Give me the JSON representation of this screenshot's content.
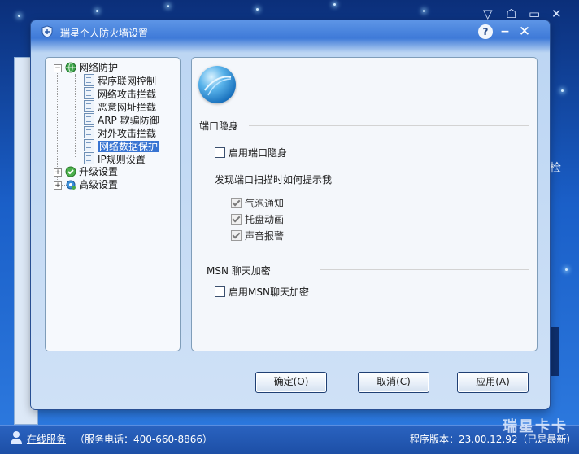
{
  "background": {
    "top_controls": [
      "▽",
      "☖",
      "▭",
      "✕"
    ],
    "right_partial_text": "检",
    "status_bar": {
      "online_service": "在线服务",
      "phone": "（服务电话：400-660-8866）",
      "version": "程序版本：23.00.12.92（已是最新）"
    },
    "watermark": "瑞星卡卡"
  },
  "dialog": {
    "title": "瑞星个人防火墙设置",
    "controls": {
      "help": "?",
      "minimize": "−",
      "close": "✕"
    },
    "tree": {
      "network_protection": "网络防护",
      "children": [
        "程序联网控制",
        "网络攻击拦截",
        "恶意网址拦截",
        "ARP 欺骗防御",
        "对外攻击拦截",
        "网络数据保护",
        "IP规则设置"
      ],
      "upgrade_settings": "升级设置",
      "advanced_settings": "高级设置",
      "selected": "网络数据保护"
    },
    "port_section": {
      "title": "端口隐身",
      "enable_label": "启用端口隐身",
      "enable_checked": false,
      "prompt_title": "发现端口扫描时如何提示我",
      "options": [
        {
          "label": "气泡通知",
          "checked": true
        },
        {
          "label": "托盘动画",
          "checked": true
        },
        {
          "label": "声音报警",
          "checked": true
        }
      ]
    },
    "msn_section": {
      "title": "MSN 聊天加密",
      "enable_label": "启用MSN聊天加密",
      "enable_checked": false
    },
    "buttons": {
      "ok": "确定(O)",
      "cancel": "取消(C)",
      "apply": "应用(A)"
    }
  }
}
